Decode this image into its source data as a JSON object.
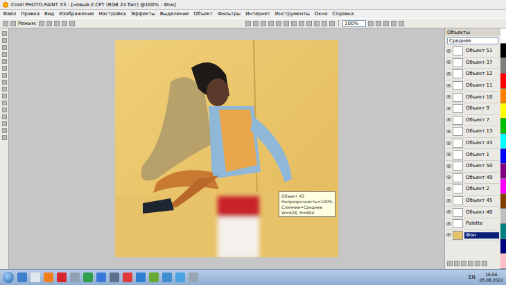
{
  "window": {
    "title": "Corel PHOTO-PAINT X3 - [новый-2.CPT (RGB 24 бит) @100% - Фон]"
  },
  "menu": [
    "Файл",
    "Правка",
    "Вид",
    "Изображение",
    "Настройка",
    "Эффекты",
    "Выделение",
    "Объект",
    "Фильтры",
    "Интернет",
    "Инструменты",
    "Окно",
    "Справка"
  ],
  "property_bar": {
    "mode_label": "Режим:",
    "zoom": "100%"
  },
  "objects_docker": {
    "title": "Объекты",
    "blend": "Среднее",
    "layers": [
      {
        "name": "Объект 51",
        "visible": true,
        "selected": false
      },
      {
        "name": "Объект 37",
        "visible": true,
        "selected": false
      },
      {
        "name": "Объект 12",
        "visible": true,
        "selected": false
      },
      {
        "name": "Объект 11",
        "visible": true,
        "selected": false
      },
      {
        "name": "Объект 10",
        "visible": true,
        "selected": false
      },
      {
        "name": "Объект 9",
        "visible": true,
        "selected": false
      },
      {
        "name": "Объект 7",
        "visible": true,
        "selected": false
      },
      {
        "name": "Объект 13",
        "visible": true,
        "selected": false
      },
      {
        "name": "Объект 43",
        "visible": true,
        "selected": false
      },
      {
        "name": "Объект 1",
        "visible": true,
        "selected": false
      },
      {
        "name": "Объект 50",
        "visible": true,
        "selected": false
      },
      {
        "name": "Объект 49",
        "visible": true,
        "selected": false
      },
      {
        "name": "Объект 2",
        "visible": true,
        "selected": false
      },
      {
        "name": "Объект 45",
        "visible": true,
        "selected": false
      },
      {
        "name": "Объект 40",
        "visible": true,
        "selected": false
      },
      {
        "name": "Palette",
        "visible": true,
        "selected": false
      },
      {
        "name": "Фон",
        "visible": true,
        "selected": true
      }
    ]
  },
  "tooltip": {
    "lines": [
      "Объект 43",
      "Непрозрачность=100%",
      "Слияние=Среднее",
      "W=628, H=604"
    ]
  },
  "palette": [
    {
      "color": "#ffffff"
    },
    {
      "color": "#000000"
    },
    {
      "color": "#808080"
    },
    {
      "color": "#ff0000"
    },
    {
      "color": "#ff8000"
    },
    {
      "color": "#ffff00"
    },
    {
      "color": "#00c000"
    },
    {
      "color": "#00ffff"
    },
    {
      "color": "#0000ff"
    },
    {
      "color": "#800080"
    },
    {
      "color": "#ff00ff"
    },
    {
      "color": "#804000"
    },
    {
      "color": "#c0c0c0"
    },
    {
      "color": "#008080"
    },
    {
      "color": "#000080"
    },
    {
      "color": "#ffc0cb"
    }
  ],
  "taskbar": {
    "language": "EN",
    "time": "16:56",
    "date": "05.08.2022"
  }
}
